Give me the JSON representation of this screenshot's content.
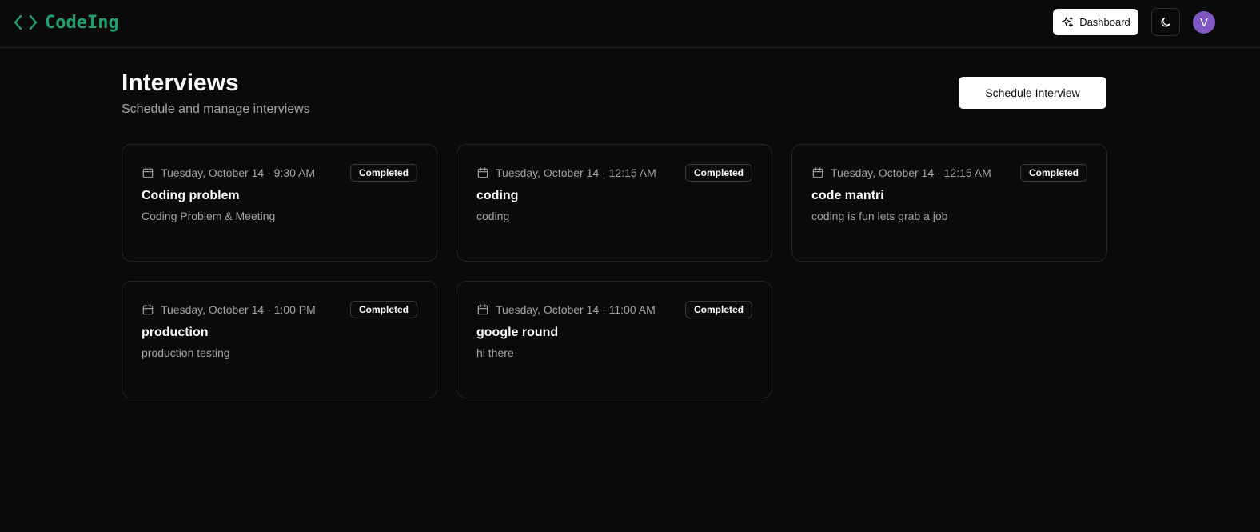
{
  "header": {
    "brand_name": "CodeIng",
    "dashboard_label": "Dashboard",
    "avatar_initial": "V"
  },
  "page": {
    "title": "Interviews",
    "subtitle": "Schedule and manage interviews",
    "schedule_button_label": "Schedule Interview"
  },
  "interviews": [
    {
      "datetime": "Tuesday, October 14 · 9:30 AM",
      "status": "Completed",
      "title": "Coding problem",
      "description": "Coding Problem & Meeting"
    },
    {
      "datetime": "Tuesday, October 14 · 12:15 AM",
      "status": "Completed",
      "title": "coding",
      "description": "coding"
    },
    {
      "datetime": "Tuesday, October 14 · 12:15 AM",
      "status": "Completed",
      "title": "code mantri",
      "description": "coding is fun lets grab a job"
    },
    {
      "datetime": "Tuesday, October 14 · 1:00 PM",
      "status": "Completed",
      "title": "production",
      "description": "production testing"
    },
    {
      "datetime": "Tuesday, October 14 · 11:00 AM",
      "status": "Completed",
      "title": "google round",
      "description": "hi there"
    }
  ],
  "icons": {
    "brand": "code-brackets-icon",
    "dashboard": "sparkles-icon",
    "theme": "moon-icon",
    "date": "calendar-icon"
  },
  "colors": {
    "background": "#0a0a0a",
    "brand": "#22a06b",
    "avatar": "#7e57c2",
    "border": "#262626",
    "muted_text": "#a3a3a3"
  }
}
